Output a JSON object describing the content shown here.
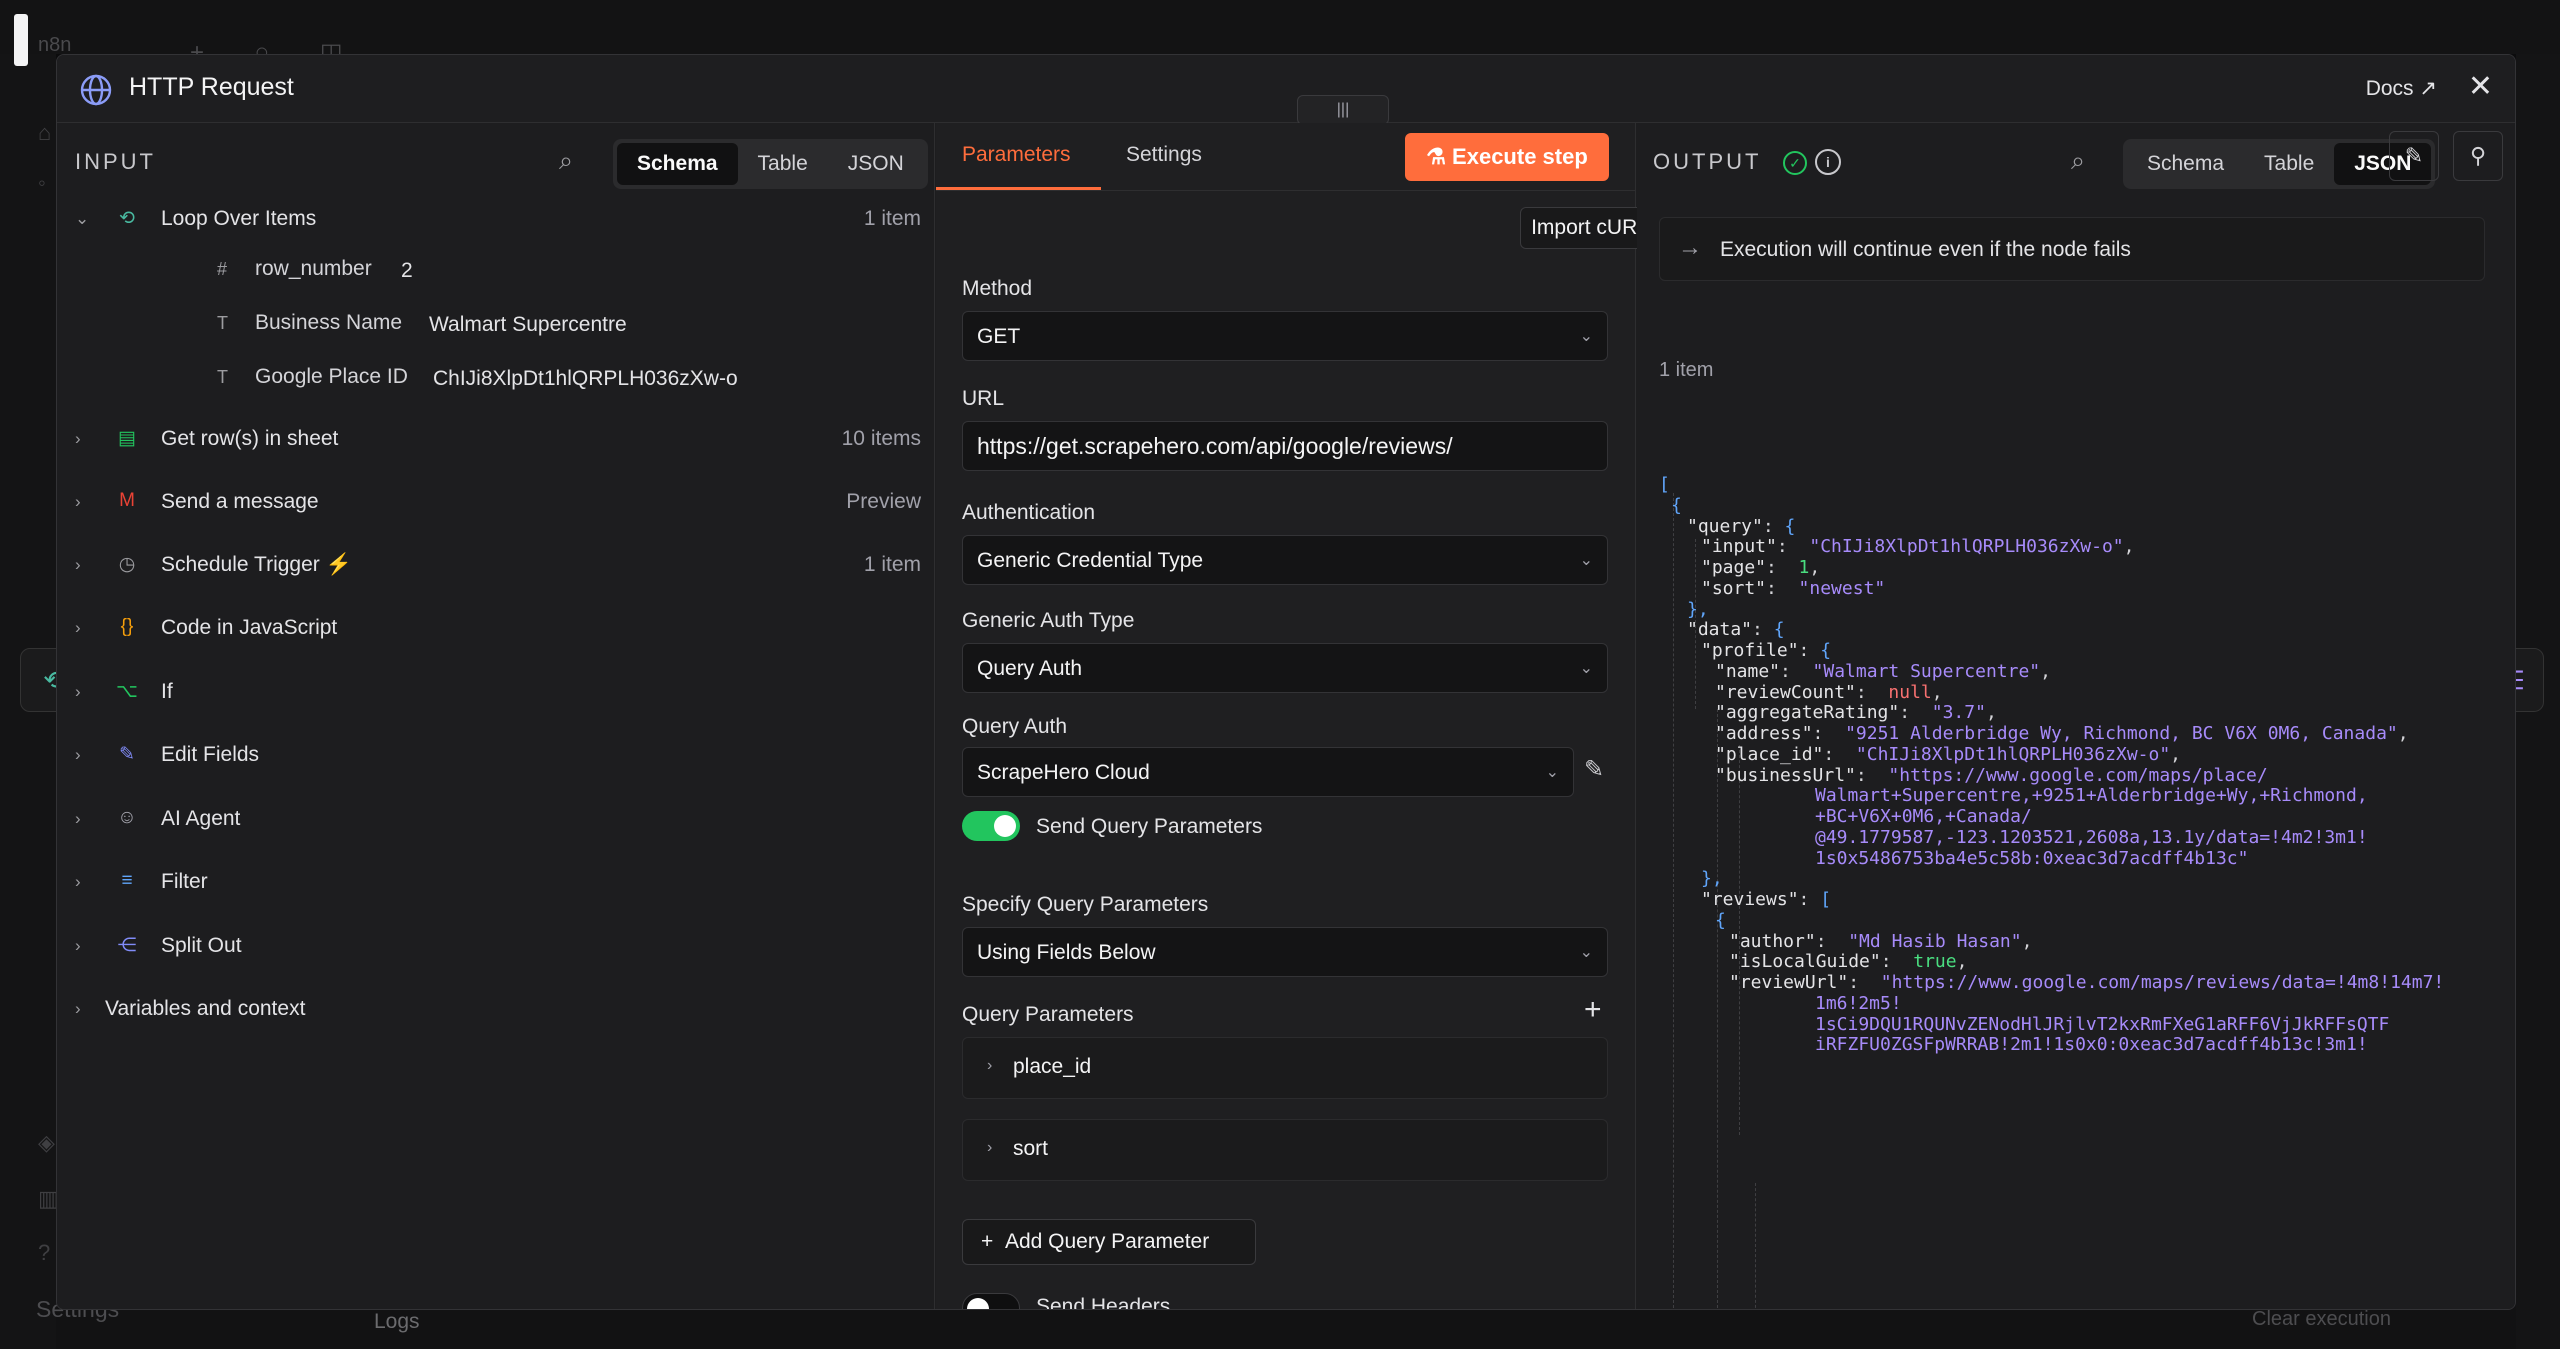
{
  "background": {
    "logo": "n8n",
    "settings_label": "Settings",
    "logs_label": "Logs",
    "clear_execution_label": "Clear execution"
  },
  "modal": {
    "title": "HTTP Request",
    "docs_label": "Docs",
    "close_icon": "close-icon"
  },
  "input_panel": {
    "title": "INPUT",
    "tabs": [
      "Schema",
      "Table",
      "JSON"
    ],
    "active_tab": "Schema",
    "nodes": [
      {
        "label": "Loop Over Items",
        "count": "1 item",
        "icon": "loop-icon",
        "expanded": true
      },
      {
        "label": "Get row(s) in sheet",
        "count": "10 items",
        "icon": "sheets-icon"
      },
      {
        "label": "Send a message",
        "count": "Preview",
        "icon": "gmail-icon"
      },
      {
        "label": "Schedule Trigger",
        "count": "1 item",
        "icon": "clock-icon"
      },
      {
        "label": "Code in JavaScript",
        "count": "",
        "icon": "code-icon"
      },
      {
        "label": "If",
        "count": "",
        "icon": "if-icon"
      },
      {
        "label": "Edit Fields",
        "count": "",
        "icon": "edit-icon"
      },
      {
        "label": "AI Agent",
        "count": "",
        "icon": "robot-icon"
      },
      {
        "label": "Filter",
        "count": "",
        "icon": "filter-icon"
      },
      {
        "label": "Split Out",
        "count": "",
        "icon": "split-icon"
      }
    ],
    "fields": [
      {
        "type": "#",
        "key": "row_number",
        "value": "2"
      },
      {
        "type": "T",
        "key": "Business Name",
        "value": "Walmart Supercentre"
      },
      {
        "type": "T",
        "key": "Google Place ID",
        "value": "ChIJi8XlpDt1hlQRPLH036zXw-o"
      }
    ],
    "variables_label": "Variables and context"
  },
  "parameters_panel": {
    "tabs": [
      "Parameters",
      "Settings"
    ],
    "active_tab": "Parameters",
    "execute_label": "Execute step",
    "import_curl_label": "Import cURL",
    "method": {
      "label": "Method",
      "value": "GET"
    },
    "url": {
      "label": "URL",
      "value": "https://get.scrapehero.com/api/google/reviews/"
    },
    "authentication": {
      "label": "Authentication",
      "value": "Generic Credential Type"
    },
    "generic_auth_type": {
      "label": "Generic Auth Type",
      "value": "Query Auth"
    },
    "query_auth": {
      "label": "Query Auth",
      "value": "ScrapeHero Cloud"
    },
    "send_query_parameters": {
      "label": "Send Query Parameters",
      "on": true
    },
    "specify_query_parameters": {
      "label": "Specify Query Parameters",
      "value": "Using Fields Below"
    },
    "query_parameters": {
      "label": "Query Parameters",
      "items": [
        "place_id",
        "sort"
      ]
    },
    "add_query_parameter_label": "Add Query Parameter",
    "send_headers": {
      "label": "Send Headers",
      "on": false
    }
  },
  "output_panel": {
    "title": "OUTPUT",
    "tabs": [
      "Schema",
      "Table",
      "JSON"
    ],
    "active_tab": "JSON",
    "notice": "Execution will continue even if the node fails",
    "item_count": "1 item",
    "json_lines": [
      [
        {
          "t": "[",
          "c": "jb"
        }
      ],
      [
        {
          "t": "{",
          "c": "jb"
        }
      ],
      [
        {
          "t": "\"query\"",
          "c": "jk"
        },
        {
          "t": ": ",
          "c": "jp"
        },
        {
          "t": "{",
          "c": "jb"
        }
      ],
      [
        {
          "t": "\"input\"",
          "c": "jk"
        },
        {
          "t": ":  ",
          "c": "jp"
        },
        {
          "t": "\"ChIJi8XlpDt1hlQRPLH036zXw-o\"",
          "c": "js"
        },
        {
          "t": ",",
          "c": "jp"
        }
      ],
      [
        {
          "t": "\"page\"",
          "c": "jk"
        },
        {
          "t": ":  ",
          "c": "jp"
        },
        {
          "t": "1",
          "c": "jn"
        },
        {
          "t": ",",
          "c": "jp"
        }
      ],
      [
        {
          "t": "\"sort\"",
          "c": "jk"
        },
        {
          "t": ":  ",
          "c": "jp"
        },
        {
          "t": "\"newest\"",
          "c": "js"
        }
      ],
      [
        {
          "t": "},",
          "c": "jb"
        }
      ],
      [
        {
          "t": "\"data\"",
          "c": "jk"
        },
        {
          "t": ": ",
          "c": "jp"
        },
        {
          "t": "{",
          "c": "jb"
        }
      ],
      [
        {
          "t": "\"profile\"",
          "c": "jk"
        },
        {
          "t": ": ",
          "c": "jp"
        },
        {
          "t": "{",
          "c": "jb"
        }
      ],
      [
        {
          "t": "\"name\"",
          "c": "jk"
        },
        {
          "t": ":  ",
          "c": "jp"
        },
        {
          "t": "\"Walmart Supercentre\"",
          "c": "js"
        },
        {
          "t": ",",
          "c": "jp"
        }
      ],
      [
        {
          "t": "\"reviewCount\"",
          "c": "jk"
        },
        {
          "t": ":  ",
          "c": "jp"
        },
        {
          "t": "null",
          "c": "jnull"
        },
        {
          "t": ",",
          "c": "jp"
        }
      ],
      [
        {
          "t": "\"aggregateRating\"",
          "c": "jk"
        },
        {
          "t": ":  ",
          "c": "jp"
        },
        {
          "t": "\"3.7\"",
          "c": "js"
        },
        {
          "t": ",",
          "c": "jp"
        }
      ],
      [
        {
          "t": "\"address\"",
          "c": "jk"
        },
        {
          "t": ":  ",
          "c": "jp"
        },
        {
          "t": "\"9251 Alderbridge Wy, Richmond, BC V6X 0M6, Canada\"",
          "c": "js"
        },
        {
          "t": ",",
          "c": "jp"
        }
      ],
      [
        {
          "t": "\"place_id\"",
          "c": "jk"
        },
        {
          "t": ":  ",
          "c": "jp"
        },
        {
          "t": "\"ChIJi8XlpDt1hlQRPLH036zXw-o\"",
          "c": "js"
        },
        {
          "t": ",",
          "c": "jp"
        }
      ],
      [
        {
          "t": "\"businessUrl\"",
          "c": "jk"
        },
        {
          "t": ":  ",
          "c": "jp"
        },
        {
          "t": "\"https://www.google.com/maps/place/",
          "c": "js"
        }
      ],
      [
        {
          "t": "Walmart+Supercentre,+9251+Alderbridge+Wy,+Richmond,",
          "c": "js"
        }
      ],
      [
        {
          "t": "+BC+V6X+0M6,+Canada/",
          "c": "js"
        }
      ],
      [
        {
          "t": "@49.1779587,-123.1203521,2608a,13.1y/data=!4m2!3m1!",
          "c": "js"
        }
      ],
      [
        {
          "t": "1s0x5486753ba4e5c58b:0xeac3d7acdff4b13c\"",
          "c": "js"
        }
      ],
      [
        {
          "t": "},",
          "c": "jb"
        }
      ],
      [
        {
          "t": "\"reviews\"",
          "c": "jk"
        },
        {
          "t": ": ",
          "c": "jp"
        },
        {
          "t": "[",
          "c": "jb"
        }
      ],
      [
        {
          "t": "{",
          "c": "jb"
        }
      ],
      [
        {
          "t": "\"author\"",
          "c": "jk"
        },
        {
          "t": ":  ",
          "c": "jp"
        },
        {
          "t": "\"Md Hasib Hasan\"",
          "c": "js"
        },
        {
          "t": ",",
          "c": "jp"
        }
      ],
      [
        {
          "t": "\"isLocalGuide\"",
          "c": "jk"
        },
        {
          "t": ":  ",
          "c": "jp"
        },
        {
          "t": "true",
          "c": "jn"
        },
        {
          "t": ",",
          "c": "jp"
        }
      ],
      [
        {
          "t": "\"reviewUrl\"",
          "c": "jk"
        },
        {
          "t": ":  ",
          "c": "jp"
        },
        {
          "t": "\"https://www.google.com/maps/reviews/data=!4m8!14m7!",
          "c": "js"
        }
      ],
      [
        {
          "t": "1m6!2m5!",
          "c": "js"
        }
      ],
      [
        {
          "t": "1sCi9DQU1RQUNvZENodHlJRjlvT2kxRmFXeG1aRFF6VjJkRFFsQTF",
          "c": "js"
        }
      ],
      [
        {
          "t": "iRFZFU0ZGSFpWRRAB!2m1!1s0x0:0xeac3d7acdff4b13c!3m1!",
          "c": "js"
        }
      ]
    ]
  },
  "colors": {
    "accent": "#ff6d3c",
    "success": "#22c55e",
    "json_string": "#a78bfa",
    "json_number": "#4ade80",
    "json_null": "#f87171"
  }
}
